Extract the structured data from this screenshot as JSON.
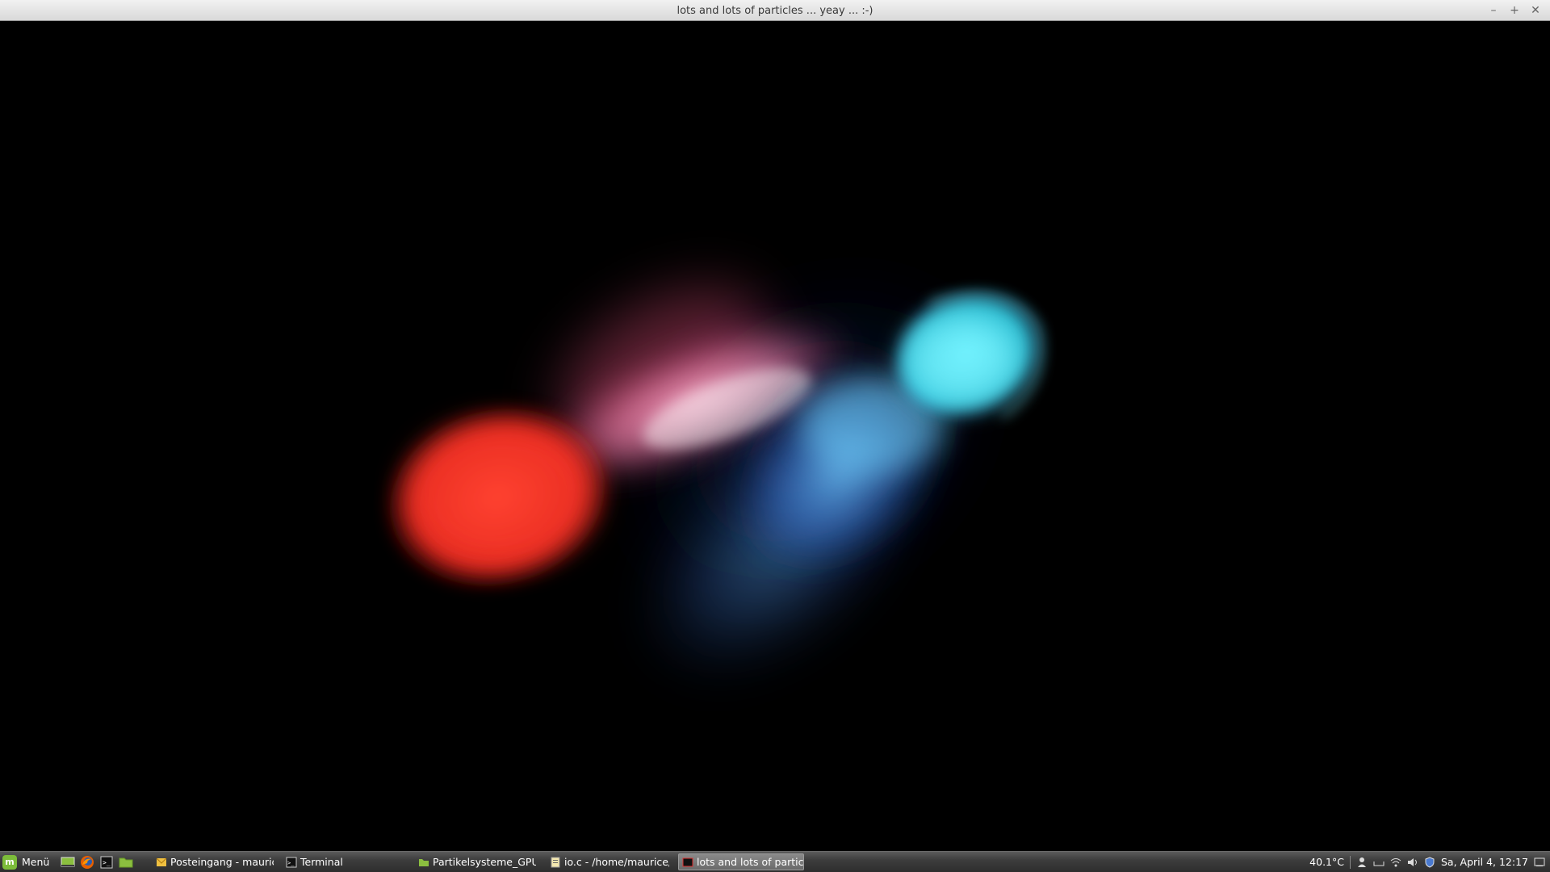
{
  "window": {
    "title": "lots and lots of particles ... yeay ... :-)",
    "minimize_glyph": "–",
    "maximize_glyph": "+",
    "close_glyph": "✕"
  },
  "scene": {
    "background_color": "#000000",
    "clusters": [
      {
        "name": "red-cluster",
        "color": "#ff3a2a"
      },
      {
        "name": "pink-bridge",
        "color": "#ff9ec8"
      },
      {
        "name": "cyan-cluster",
        "color": "#3ee0f5"
      },
      {
        "name": "blue-halo",
        "color": "#4a8cff"
      }
    ]
  },
  "taskbar": {
    "menu_label": "Menü",
    "launchers": [
      {
        "icon": "show-desktop-icon"
      },
      {
        "icon": "firefox-icon"
      },
      {
        "icon": "terminal-icon"
      },
      {
        "icon": "folder-icon"
      }
    ],
    "tasks": [
      {
        "label": "Posteingang - mauric...",
        "icon": "mail-icon",
        "active": false
      },
      {
        "label": "Terminal",
        "icon": "terminal-icon",
        "active": false
      },
      {
        "label": "Partikelsysteme_GPU",
        "icon": "folder-icon",
        "active": false
      },
      {
        "label": "io.c - /home/maurice/...",
        "icon": "editor-icon",
        "active": false
      },
      {
        "label": "lots and lots of particl...",
        "icon": "app-window-icon",
        "active": true
      }
    ],
    "tray": {
      "temperature": "40.1°C",
      "clock": "Sa, April  4, 12:17"
    }
  }
}
